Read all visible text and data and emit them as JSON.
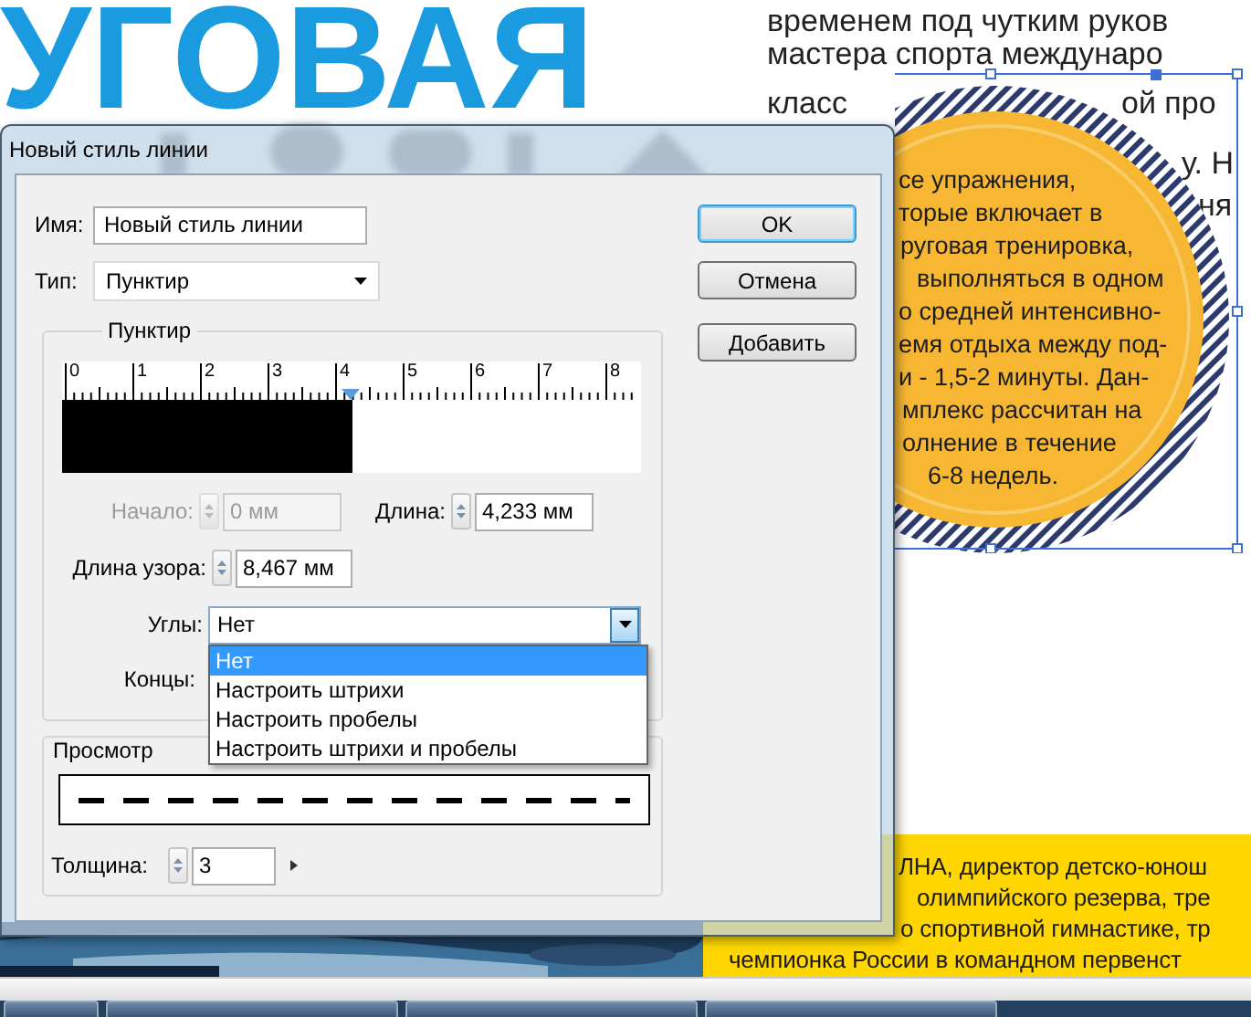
{
  "document": {
    "headline": "УГОВАЯ",
    "column_lines": [
      "временем под чутким руков",
      "мастера спорта междунаро",
      "класс",
      "ой про",
      "у. Н",
      "ня"
    ],
    "circle_lines": [
      "се упражнения,",
      "торые включает в",
      "руговая тренировка,",
      "выполняться в одном",
      "о средней интенсивно-",
      "емя отдыха между под-",
      "и - 1,5-2 минуты. Дан-",
      "мплекс рассчитан на",
      "олнение в течение",
      "6-8 недель."
    ],
    "band_lines": [
      "ЛНА, директор детско-юнош",
      "олимпийского резерва, тре",
      "о спортивной гимнастике, тр",
      "чемпионка России в командном первенст"
    ]
  },
  "dialog": {
    "title": "Новый стиль линии",
    "name": {
      "label": "Имя:",
      "value": "Новый стиль линии"
    },
    "type": {
      "label": "Тип:",
      "value": "Пунктир"
    },
    "dash_group": {
      "title": "Пунктир",
      "ruler_labels": [
        "0",
        "1",
        "2",
        "3",
        "4",
        "5",
        "6",
        "7",
        "8"
      ],
      "level": 0.5,
      "start": {
        "label": "Начало:",
        "value": "0 мм",
        "disabled": true
      },
      "length": {
        "label": "Длина:",
        "value": "4,233 мм",
        "disabled": false
      },
      "pattern_length": {
        "label": "Длина узора:",
        "value": "8,467 мм",
        "disabled": false
      },
      "corners": {
        "label": "Углы:",
        "value": "Нет",
        "expanded": true,
        "options": [
          {
            "label": "Нет",
            "selected": true
          },
          {
            "label": "Настроить штрихи",
            "selected": false
          },
          {
            "label": "Настроить пробелы",
            "selected": false
          },
          {
            "label": "Настроить штрихи и пробелы",
            "selected": false
          }
        ]
      },
      "ends": {
        "label": "Концы:"
      }
    },
    "preview": {
      "title": "Просмотр"
    },
    "weight": {
      "label": "Толщина:",
      "value": "3",
      "disabled": false
    },
    "buttons": [
      {
        "label": "OK",
        "default": true
      },
      {
        "label": "Отмена",
        "default": false
      },
      {
        "label": "Добавить",
        "default": false
      }
    ]
  }
}
